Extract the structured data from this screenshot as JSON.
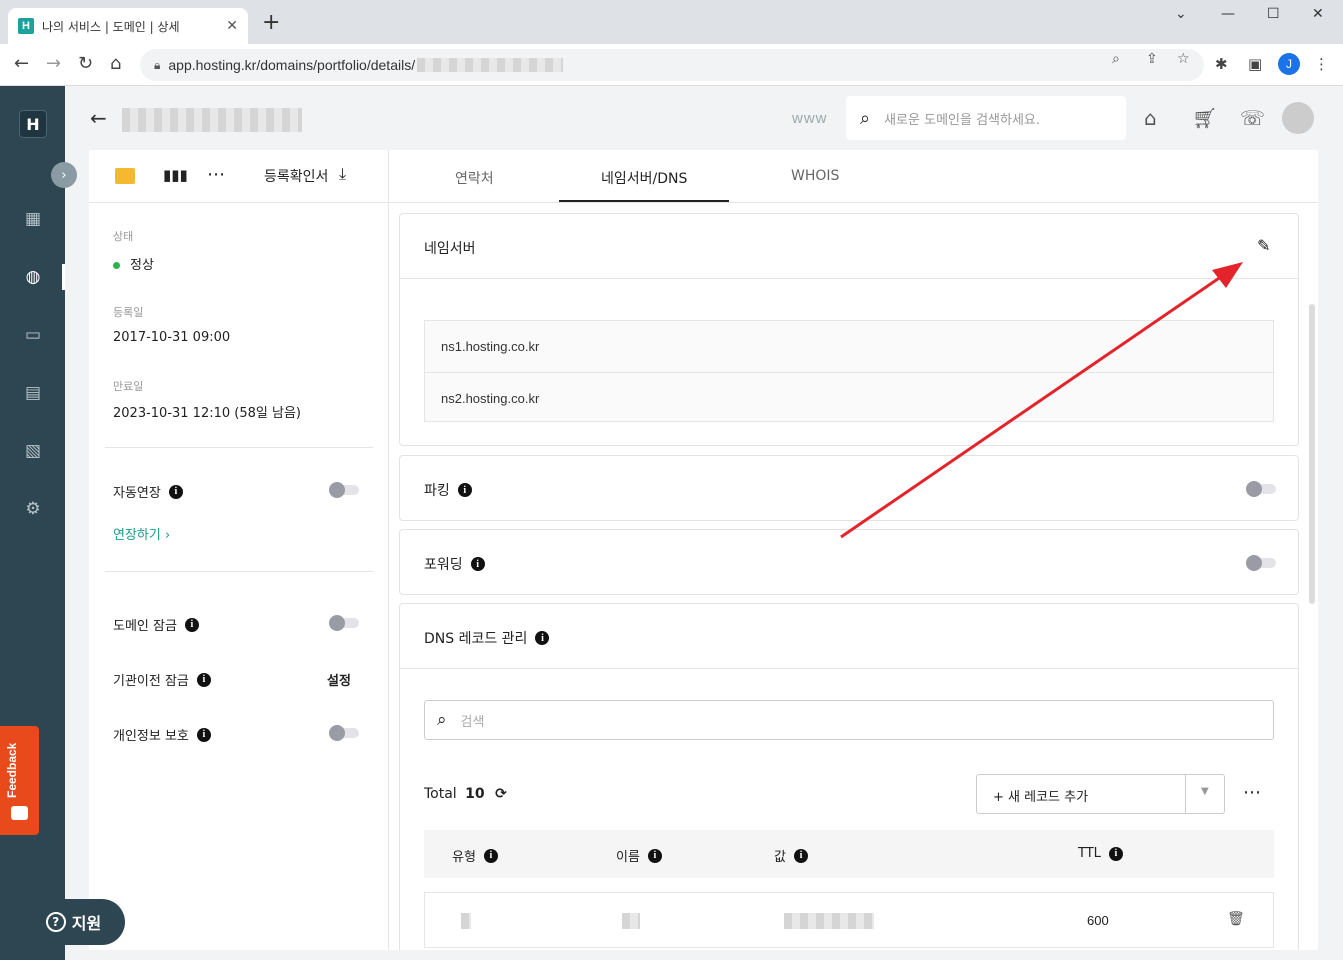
{
  "browser": {
    "tab_title": "나의 서비스 | 도메인 | 상세",
    "tab_favicon": "H",
    "url": "app.hosting.kr/domains/portfolio/details/",
    "profile_initial": "J"
  },
  "app": {
    "logo": "H",
    "www": "www",
    "search_placeholder": "새로운 도메인을 검색하세요.",
    "feedback": "Feedback",
    "help": "지원"
  },
  "left_panel": {
    "cert_label": "등록확인서",
    "status_label": "상태",
    "status_value": "정상",
    "registered_label": "등록일",
    "registered_value": "2017-10-31 09:00",
    "expires_label": "만료일",
    "expires_value": "2023-10-31 12:10 (58일 남음)",
    "auto_renew": "자동연장",
    "renew_link": "연장하기",
    "domain_lock": "도메인 잠금",
    "transfer_lock": "기관이전 잠금",
    "transfer_lock_action": "설정",
    "privacy": "개인정보 보호"
  },
  "tabs": [
    "연락처",
    "네임서버/DNS",
    "WHOIS"
  ],
  "nameserver": {
    "title": "네임서버",
    "servers": [
      "ns1.hosting.co.kr",
      "ns2.hosting.co.kr"
    ]
  },
  "parking": {
    "title": "파킹"
  },
  "forwarding": {
    "title": "포워딩"
  },
  "dns": {
    "title": "DNS 레코드 관리",
    "search_placeholder": "검색",
    "total_label": "Total",
    "total_count": "10",
    "add_record": "+ 새 레코드 추가",
    "columns": [
      "유형",
      "이름",
      "값",
      "TTL"
    ],
    "rows": [
      {
        "ttl": "600"
      }
    ]
  },
  "colors": {
    "accent": "#1a9a8c",
    "sidebar": "#2d4651",
    "annotation_arrow": "#e3242b"
  }
}
